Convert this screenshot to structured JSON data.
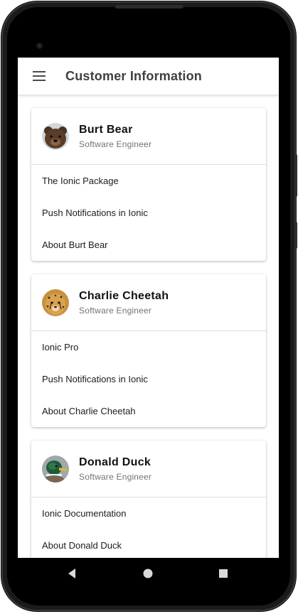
{
  "app": {
    "title": "Customer Information"
  },
  "toolbar": {
    "menu_icon": "menu-icon"
  },
  "cards": [
    {
      "name": "Burt Bear",
      "job": "Software Engineer",
      "avatar": "bear-avatar",
      "items": [
        "The Ionic Package",
        "Push Notifications in Ionic",
        "About Burt Bear"
      ]
    },
    {
      "name": "Charlie Cheetah",
      "job": "Software Engineer",
      "avatar": "cheetah-avatar",
      "items": [
        "Ionic Pro",
        "Push Notifications in Ionic",
        "About Charlie Cheetah"
      ]
    },
    {
      "name": "Donald Duck",
      "job": "Software Engineer",
      "avatar": "duck-avatar",
      "items": [
        "Ionic Documentation",
        "About Donald Duck"
      ]
    }
  ],
  "navbar": {
    "back": "back-icon",
    "home": "home-icon",
    "recents": "recents-icon"
  }
}
